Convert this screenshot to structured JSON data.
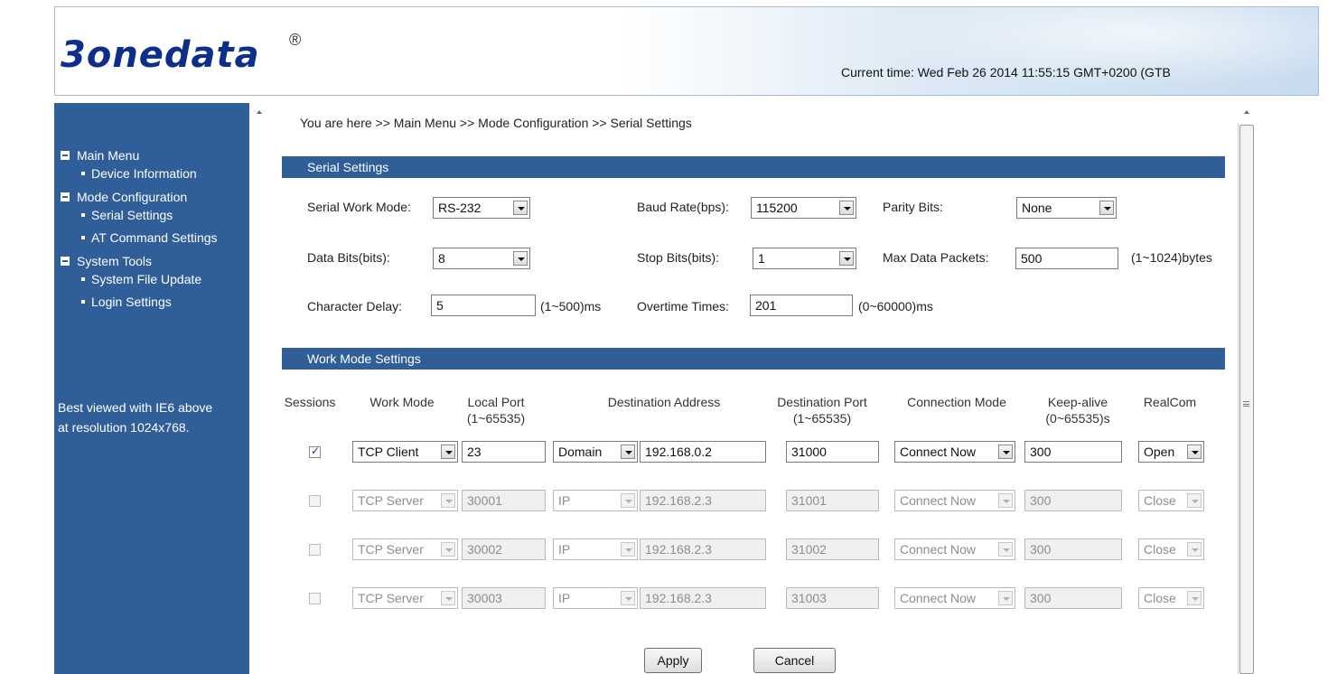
{
  "header": {
    "logo_text": "3onedata",
    "logo_mark": "®",
    "current_time": "Current time: Wed Feb 26 2014 11:55:15 GMT+0200 (GTB"
  },
  "sidebar": {
    "menu": [
      {
        "type": "group",
        "label": "Main Menu"
      },
      {
        "type": "item",
        "label": "Device Information"
      },
      {
        "type": "group",
        "label": "Mode Configuration"
      },
      {
        "type": "item",
        "label": "Serial Settings"
      },
      {
        "type": "item",
        "label": "AT Command Settings"
      },
      {
        "type": "group",
        "label": "System Tools"
      },
      {
        "type": "item",
        "label": "System File Update"
      },
      {
        "type": "item",
        "label": "Login Settings"
      }
    ],
    "note_line1": "Best viewed with IE6 above",
    "note_line2": "at resolution 1024x768."
  },
  "breadcrumb": "You are here >> Main Menu >> Mode Configuration >> Serial Settings",
  "serial": {
    "title": "Serial Settings",
    "work_mode_label": "Serial Work Mode:",
    "work_mode_value": "RS-232",
    "baud_label": "Baud Rate(bps):",
    "baud_value": "115200",
    "parity_label": "Parity Bits:",
    "parity_value": "None",
    "data_bits_label": "Data Bits(bits):",
    "data_bits_value": "8",
    "stop_bits_label": "Stop Bits(bits):",
    "stop_bits_value": "1",
    "max_packets_label": "Max Data Packets:",
    "max_packets_value": "500",
    "max_packets_unit": "(1~1024)bytes",
    "char_delay_label": "Character Delay:",
    "char_delay_value": "5",
    "char_delay_unit": "(1~500)ms",
    "overtime_label": "Overtime Times:",
    "overtime_value": "201",
    "overtime_unit": "(0~60000)ms"
  },
  "workmode": {
    "title": "Work Mode Settings",
    "headers": {
      "sessions": "Sessions",
      "work_mode": "Work Mode",
      "local_port": "Local Port",
      "local_port_range": "(1~65535)",
      "dest_addr": "Destination Address",
      "dest_port": "Destination Port",
      "dest_port_range": "(1~65535)",
      "conn_mode": "Connection Mode",
      "keepalive": "Keep-alive",
      "keepalive_range": "(0~65535)s",
      "realcom": "RealCom"
    },
    "rows": [
      {
        "checked": true,
        "mode": "TCP Client",
        "local_port": "23",
        "addr_type": "Domain",
        "addr": "192.168.0.2",
        "dest_port": "31000",
        "conn": "Connect Now",
        "keepalive": "300",
        "realcom": "Open"
      },
      {
        "checked": false,
        "mode": "TCP Server",
        "local_port": "30001",
        "addr_type": "IP",
        "addr": "192.168.2.3",
        "dest_port": "31001",
        "conn": "Connect Now",
        "keepalive": "300",
        "realcom": "Close"
      },
      {
        "checked": false,
        "mode": "TCP Server",
        "local_port": "30002",
        "addr_type": "IP",
        "addr": "192.168.2.3",
        "dest_port": "31002",
        "conn": "Connect Now",
        "keepalive": "300",
        "realcom": "Close"
      },
      {
        "checked": false,
        "mode": "TCP Server",
        "local_port": "30003",
        "addr_type": "IP",
        "addr": "192.168.2.3",
        "dest_port": "31003",
        "conn": "Connect Now",
        "keepalive": "300",
        "realcom": "Close"
      }
    ]
  },
  "buttons": {
    "apply": "Apply",
    "cancel": "Cancel"
  }
}
